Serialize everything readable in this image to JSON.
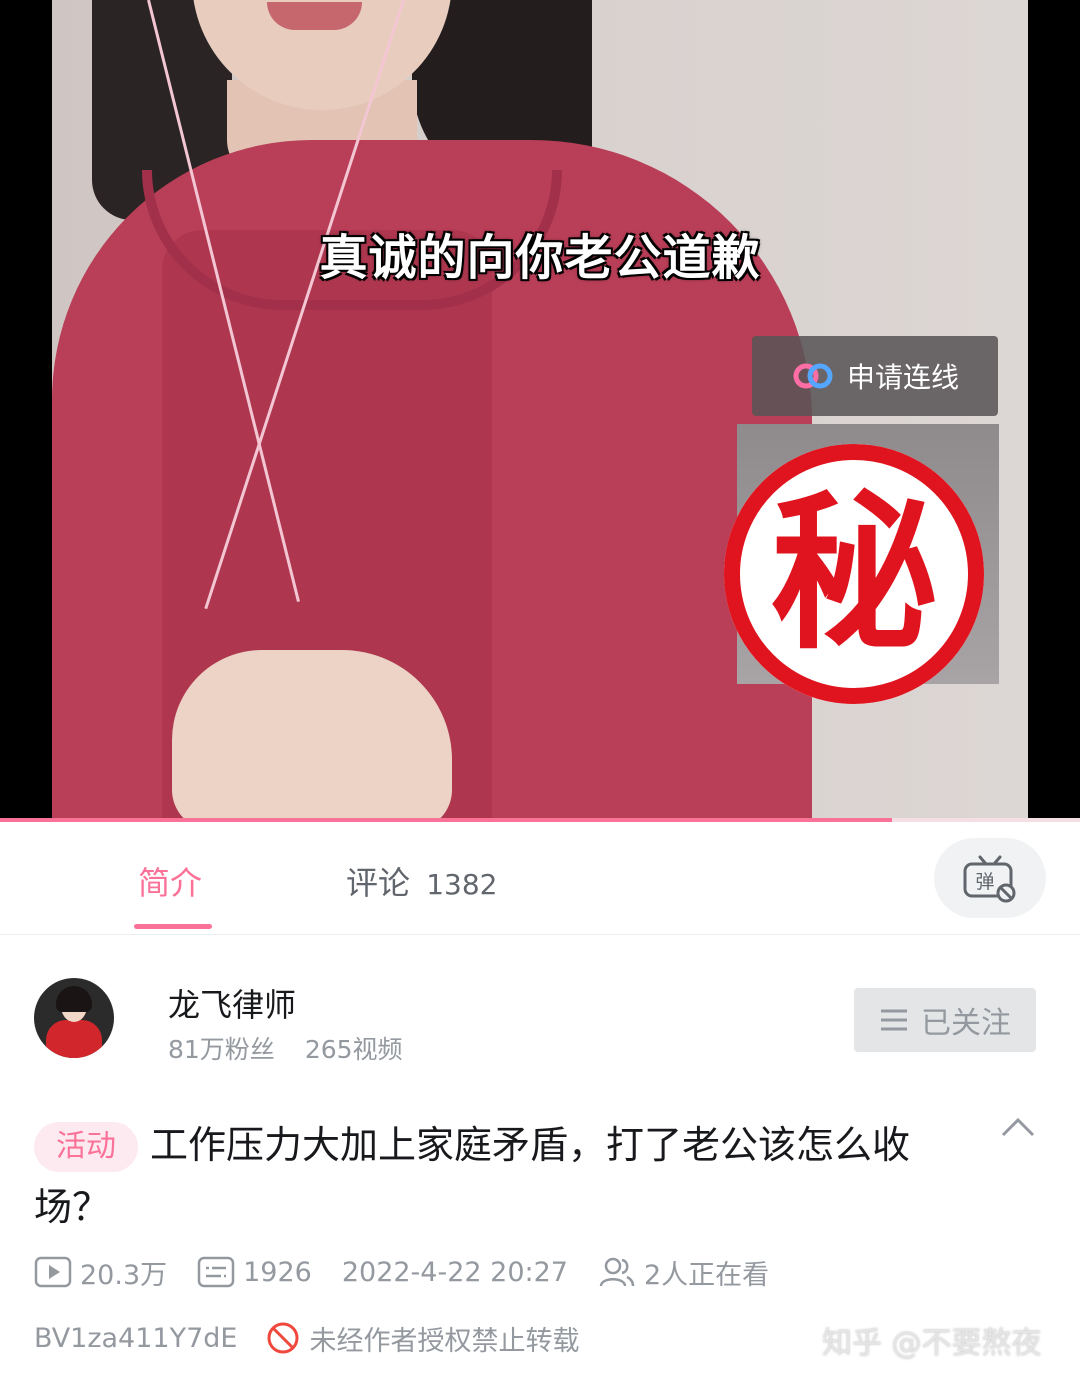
{
  "video": {
    "caption": "真诚的向你老公道歉",
    "connect_label": "申请连线",
    "secret_mark": "秘",
    "progress": 0.826
  },
  "tabs": {
    "intro_label": "简介",
    "comments_label": "评论",
    "comments_count": "1382",
    "danmaku_icon": "danmaku-off-icon"
  },
  "uploader": {
    "name": "龙飞律师",
    "fans": "81万粉丝",
    "videos": "265视频",
    "follow_label": "已关注"
  },
  "video_info": {
    "tag": "活动",
    "title": "工作压力大加上家庭矛盾，打了老公该怎么收场？",
    "views": "20.3万",
    "danmaku_count": "1926",
    "publish_time": "2022-4-22 20:27",
    "watching": "2人正在看",
    "bvid": "BV1za411Y7dE",
    "copyright_notice": "未经作者授权禁止转载"
  },
  "watermark": "知乎 @不要熬夜",
  "colors": {
    "accent": "#fb7299",
    "secondary_text": "#9499a0"
  }
}
